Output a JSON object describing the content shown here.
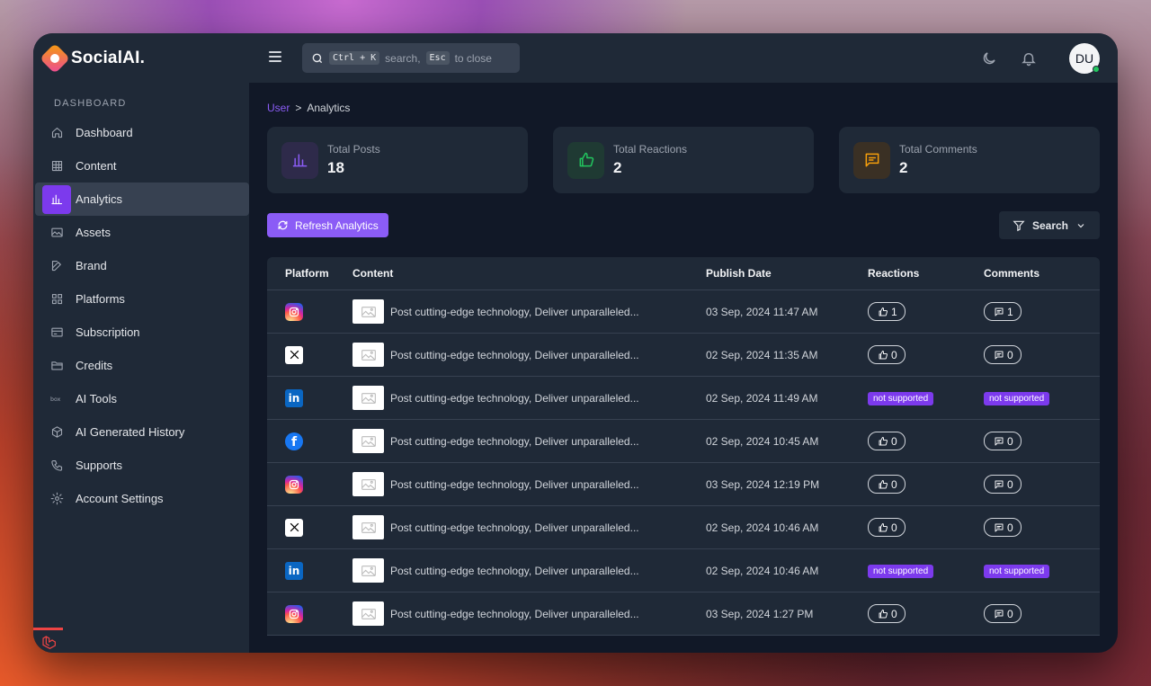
{
  "app": {
    "name": "SocialAI."
  },
  "sidebar": {
    "heading": "DASHBOARD",
    "items": [
      {
        "label": "Dashboard",
        "icon": "home-icon"
      },
      {
        "label": "Content",
        "icon": "grid-icon"
      },
      {
        "label": "Analytics",
        "icon": "bar-chart-icon",
        "active": true
      },
      {
        "label": "Assets",
        "icon": "image-icon"
      },
      {
        "label": "Brand",
        "icon": "edit-icon"
      },
      {
        "label": "Platforms",
        "icon": "apps-icon"
      },
      {
        "label": "Subscription",
        "icon": "credit-card-icon"
      },
      {
        "label": "Credits",
        "icon": "folder-icon"
      },
      {
        "label": "AI Tools",
        "icon": "box-icon"
      },
      {
        "label": "AI Generated History",
        "icon": "cube-icon"
      },
      {
        "label": "Supports",
        "icon": "phone-icon"
      },
      {
        "label": "Account Settings",
        "icon": "gear-icon"
      }
    ]
  },
  "topbar": {
    "search": {
      "kbd1": "Ctrl + K",
      "text1": "search,",
      "kbd2": "Esc",
      "text2": "to close"
    },
    "avatar_initials": "DU"
  },
  "breadcrumb": {
    "parent": "User",
    "separator": ">",
    "current": "Analytics"
  },
  "stats": [
    {
      "label": "Total Posts",
      "value": "18",
      "icon": "bar-chart-icon",
      "color": "#8b5cf6",
      "bg": "#2e2a4a"
    },
    {
      "label": "Total Reactions",
      "value": "2",
      "icon": "thumbs-up-icon",
      "color": "#22c55e",
      "bg": "#1f3a33"
    },
    {
      "label": "Total Comments",
      "value": "2",
      "icon": "message-icon",
      "color": "#f59e0b",
      "bg": "#3a3024"
    }
  ],
  "actions": {
    "refresh_label": "Refresh Analytics",
    "filter_label": "Search"
  },
  "table": {
    "columns": [
      "Platform",
      "Content",
      "Publish Date",
      "Reactions",
      "Comments"
    ],
    "rows": [
      {
        "platform": "instagram",
        "content": "Post cutting-edge technology, Deliver unparalleled...",
        "date": "03 Sep, 2024 11:47 AM",
        "reactions": "1",
        "comments": "1"
      },
      {
        "platform": "x",
        "content": "Post cutting-edge technology, Deliver unparalleled...",
        "date": "02 Sep, 2024 11:35 AM",
        "reactions": "0",
        "comments": "0"
      },
      {
        "platform": "linkedin",
        "content": "Post cutting-edge technology, Deliver unparalleled...",
        "date": "02 Sep, 2024 11:49 AM",
        "reactions": "not supported",
        "comments": "not supported"
      },
      {
        "platform": "facebook",
        "content": "Post cutting-edge technology, Deliver unparalleled...",
        "date": "02 Sep, 2024 10:45 AM",
        "reactions": "0",
        "comments": "0"
      },
      {
        "platform": "instagram",
        "content": "Post cutting-edge technology, Deliver unparalleled...",
        "date": "03 Sep, 2024 12:19 PM",
        "reactions": "0",
        "comments": "0"
      },
      {
        "platform": "x",
        "content": "Post cutting-edge technology, Deliver unparalleled...",
        "date": "02 Sep, 2024 10:46 AM",
        "reactions": "0",
        "comments": "0"
      },
      {
        "platform": "linkedin",
        "content": "Post cutting-edge technology, Deliver unparalleled...",
        "date": "02 Sep, 2024 10:46 AM",
        "reactions": "not supported",
        "comments": "not supported"
      },
      {
        "platform": "instagram",
        "content": "Post cutting-edge technology, Deliver unparalleled...",
        "date": "03 Sep, 2024 1:27 PM",
        "reactions": "0",
        "comments": "0"
      }
    ]
  }
}
